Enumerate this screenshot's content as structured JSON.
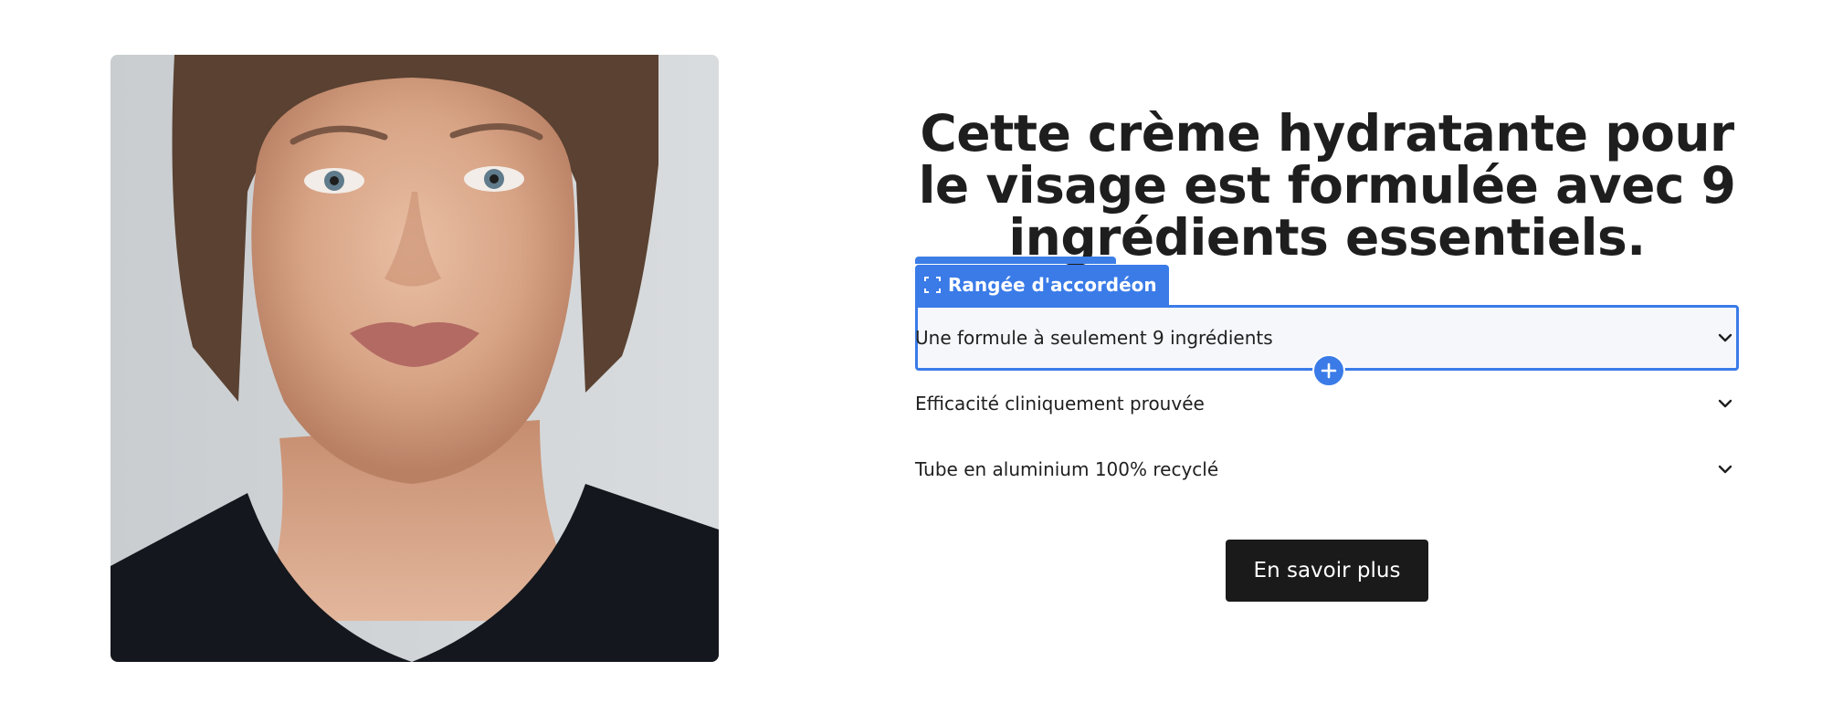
{
  "headline": "Cette crème hydratante pour le visage est formulée avec 9 ingrédients essentiels.",
  "editor": {
    "badge_label": "Rangée d'accordéon",
    "badge_icon": "frame-select-icon",
    "add_icon": "plus-icon",
    "accent_color": "#3a7be8"
  },
  "accordion": {
    "items": [
      {
        "label": "Une formule à seulement 9 ingrédients",
        "expanded": false,
        "selected": true
      },
      {
        "label": "Efficacité cliniquement prouvée",
        "expanded": false,
        "selected": false
      },
      {
        "label": "Tube en aluminium 100% recyclé",
        "expanded": false,
        "selected": false
      }
    ],
    "toggle_icon": "chevron-down-icon"
  },
  "cta": {
    "label": "En savoir plus"
  },
  "media": {
    "icon": "product-portrait-image"
  }
}
